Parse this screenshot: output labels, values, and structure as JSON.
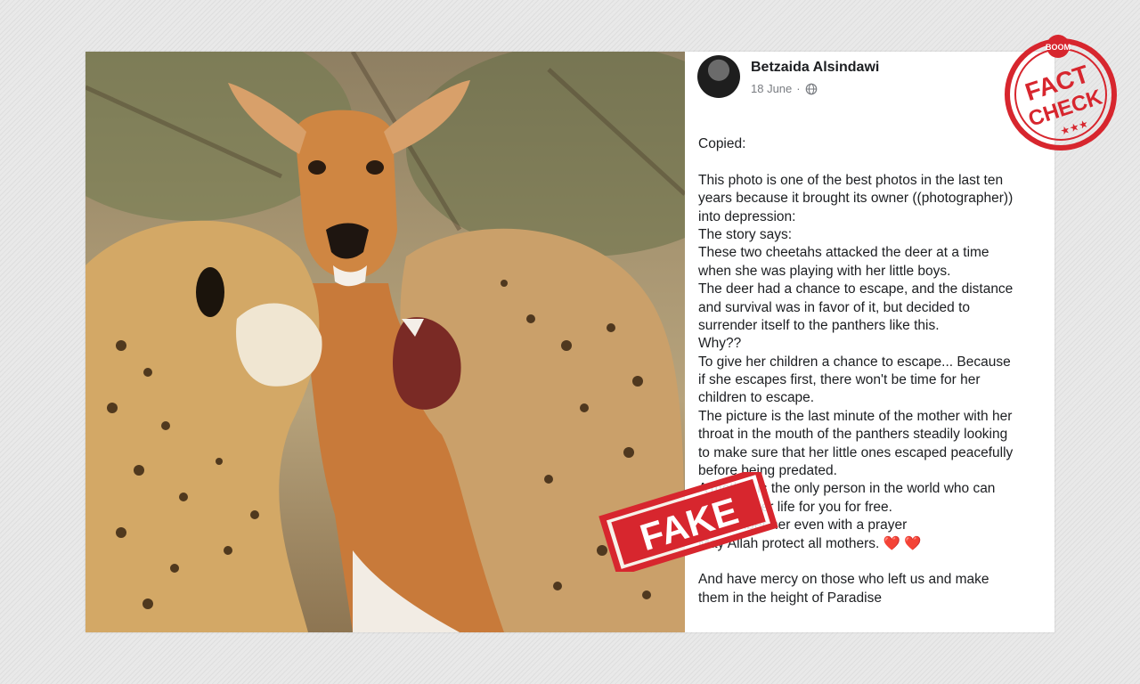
{
  "post": {
    "author": "Betzaida Alsindawi",
    "date": "18 June",
    "separator": "·",
    "privacy_icon": "globe-icon",
    "lines": [
      "Copied:",
      "",
      "This photo is one of the best photos in the last ten",
      "years because it brought its owner ((photographer))",
      "into depression:",
      "The story says:",
      "These two cheetahs attacked the deer at a time",
      "when she was playing with her little boys.",
      "The deer had a chance to escape, and the distance",
      "and survival was in favor of it, but decided to",
      "surrender itself to the panthers like this.",
      "Why??",
      "To give her children a chance to escape... Because",
      "if she escapes first, there won't be time for her",
      "children to escape.",
      "The picture is the last minute of the mother with her",
      "throat in the mouth of the panthers steadily looking",
      "to make sure that her little ones escaped peacefully",
      "before being predated.",
      "A mother is the only person in the world who can",
      "give you her life for you for free.",
      "Remember her even with a prayer",
      "May Allah protect all mothers.",
      "",
      "And have mercy on those who left us and make",
      "them in the height of Paradise"
    ],
    "hearts": "❤️ ❤️"
  },
  "stamps": {
    "fact_check_top": "BOOM",
    "fact_check_line1": "FACT",
    "fact_check_line2": "CHECK",
    "fact_check_stars": "★★★",
    "fake_label": "FAKE"
  },
  "colors": {
    "stamp_red": "#d7262e",
    "heart_red": "#e0193a",
    "text": "#1c1e21",
    "meta": "#7a7d82"
  }
}
